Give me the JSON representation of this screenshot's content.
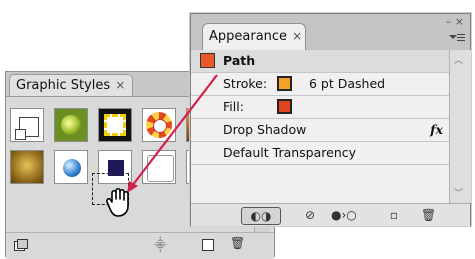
{
  "graphic_styles": {
    "tab_label": "Graphic Styles",
    "tab_close": "×",
    "swatches": [
      "default",
      "green-orb",
      "yellow-dash-frame",
      "sunburst",
      "clipped-orange",
      "gold-texture",
      "blue-sphere",
      "navy-square",
      "white-square",
      "orange-edge"
    ],
    "footer_icons": [
      "library-menu-icon",
      "break-link-icon",
      "new-style-icon",
      "delete-icon"
    ]
  },
  "appearance": {
    "tab_label": "Appearance",
    "tab_close": "×",
    "window_close": "– ×",
    "menu_icon": "menu-icon",
    "object_label": "Path",
    "stroke_label": "Stroke:",
    "stroke_value": "6 pt Dashed",
    "fill_label": "Fill:",
    "effect_label": "Drop Shadow",
    "fx_label": "fx",
    "transparency_label": "Default Transparency",
    "colors": {
      "path_swatch": "#e8582a",
      "stroke_swatch": "#f4a12a",
      "fill_swatch": "#e0451f",
      "arrow": "#d0214b"
    }
  }
}
